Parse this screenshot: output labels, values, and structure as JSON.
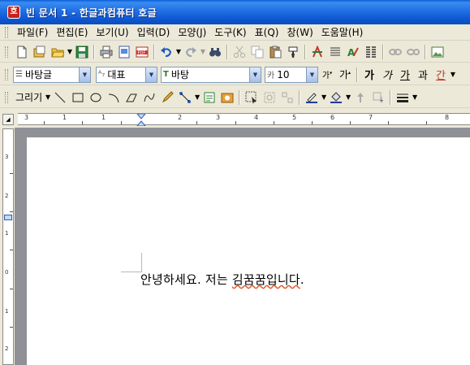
{
  "window": {
    "title": "빈 문서 1 - 한글과컴퓨터 호글",
    "icon_text": "호"
  },
  "menu": [
    {
      "label": "파일(F)"
    },
    {
      "label": "편집(E)"
    },
    {
      "label": "보기(U)"
    },
    {
      "label": "입력(D)"
    },
    {
      "label": "모양(J)"
    },
    {
      "label": "도구(K)"
    },
    {
      "label": "표(Q)"
    },
    {
      "label": "창(W)"
    },
    {
      "label": "도움말(H)"
    }
  ],
  "format_bar": {
    "style": "바탕글",
    "language": "대표",
    "font": "바탕",
    "font_size": "10",
    "bold": "가",
    "italic": "가",
    "underline": "가",
    "strike": "과",
    "color": "간"
  },
  "draw_bar": {
    "label": "그리기"
  },
  "ruler": {
    "marks": [
      "3",
      "1",
      "1",
      "2",
      "3",
      "4",
      "5",
      "6",
      "7",
      "8"
    ]
  },
  "vruler": {
    "marks": [
      "3",
      "2",
      "1",
      "0",
      "1",
      "2"
    ]
  },
  "document": {
    "text_plain": "안녕하세요. 저는 ",
    "text_err": "김꿈꿈입니다",
    "text_end": "."
  }
}
